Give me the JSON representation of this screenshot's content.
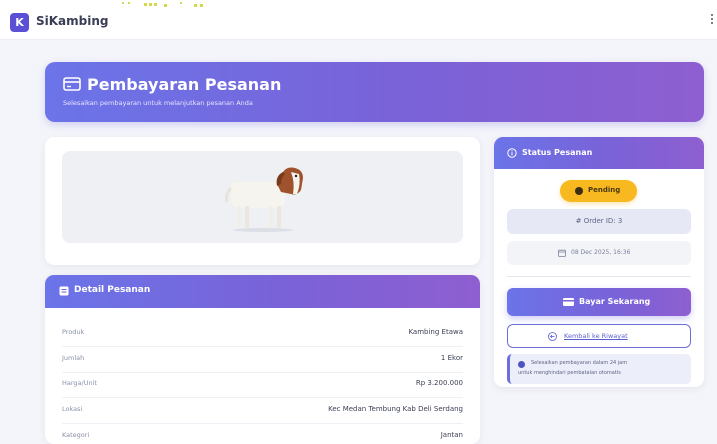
{
  "app": {
    "logo_letter": "K",
    "name": "SiKambing"
  },
  "hero": {
    "title": "Pembayaran Pesanan",
    "subtitle": "Selesaikan pembayaran untuk melanjutkan pesanan Anda"
  },
  "detail": {
    "title": "Detail Pesanan",
    "rows": [
      {
        "label": "Produk",
        "value": "Kambing Etawa"
      },
      {
        "label": "Jumlah",
        "value": "1 Ekor"
      },
      {
        "label": "Harga/Unit",
        "value": "Rp 3.200.000"
      },
      {
        "label": "Lokasi",
        "value": "Kec Medan Tembung Kab Deli Serdang"
      },
      {
        "label": "Kategori",
        "value": "Jantan"
      }
    ]
  },
  "status": {
    "title": "Status Pesanan",
    "badge": "Pending",
    "order_id": "# Order ID: 3",
    "date": "08 Dec 2025, 16:36",
    "pay_button": "Bayar Sekarang",
    "back_button": "Kembali ke Riwayat",
    "info_line1": "Selesaikan pembayaran dalam 24 jam",
    "info_line2": "untuk menghindari pembatalan otomatis"
  },
  "colors": {
    "accent": "#6b74e8",
    "accent_end": "#8e5fd0",
    "pending": "#f8b81f",
    "background": "#f4f5fa"
  }
}
